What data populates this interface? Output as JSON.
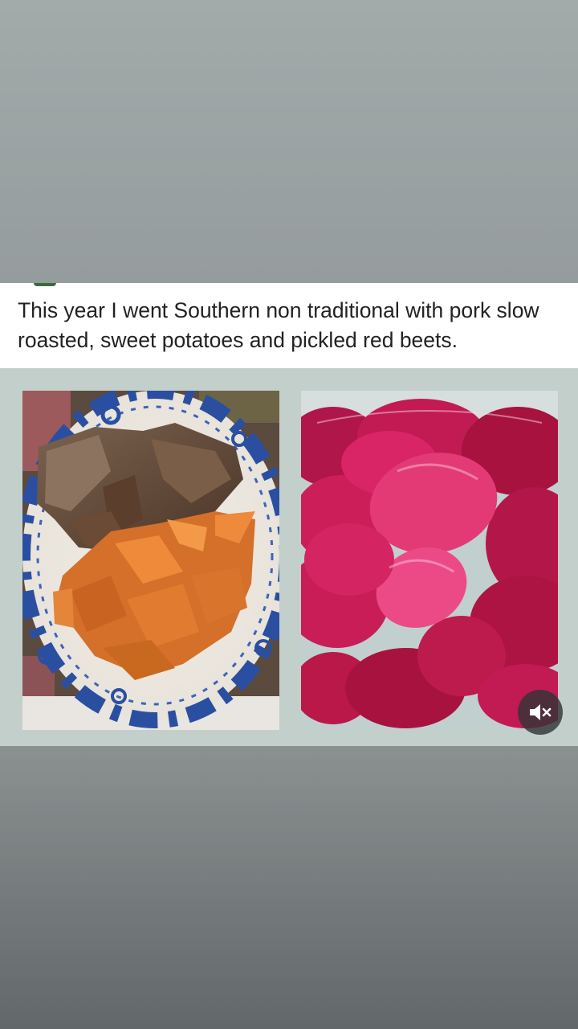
{
  "post": {
    "caption": "This year I went Southern non traditional with pork slow roasted, sweet potatoes and pickled red beets."
  },
  "photos": [
    {
      "subject": "pork-and-sweet-potatoes-plate"
    },
    {
      "subject": "pickled-red-beets"
    }
  ],
  "controls": {
    "mute_icon": "speaker-muted-icon"
  },
  "colors": {
    "top_background": "#a2aaaa",
    "bottom_background": "#626869",
    "image_panel": "#c3cfcb",
    "caption_text": "#222222",
    "beet": "#d81f5f",
    "sweet_potato": "#e27a2c",
    "plate_pattern": "#2b4fa0"
  }
}
